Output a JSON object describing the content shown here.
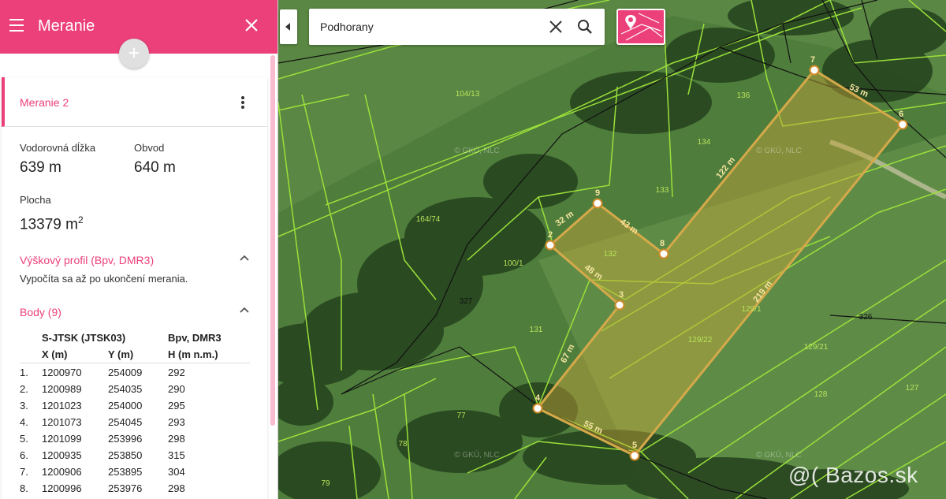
{
  "panel": {
    "title": "Meranie",
    "add_label": "+",
    "measurement": {
      "name": "Meranie 2",
      "horizontal_length_label": "Vodorovná dĺžka",
      "horizontal_length_value": "639 m",
      "perimeter_label": "Obvod",
      "perimeter_value": "640 m",
      "area_label": "Plocha",
      "area_value": "13379 m",
      "area_unit_sup": "2",
      "elevation_title": "Výškový profil (Bpv, DMR3)",
      "elevation_note": "Vypočíta sa až po ukončení merania.",
      "points_title": "Body (9)",
      "table": {
        "crs_header": "S-JTSK (JTSK03)",
        "height_crs_header": "Bpv, DMR3",
        "col_x": "X (m)",
        "col_y": "Y (m)",
        "col_h": "H (m n.m.)",
        "rows": [
          {
            "n": "1.",
            "x": "1200970",
            "y": "254009",
            "h": "292"
          },
          {
            "n": "2.",
            "x": "1200989",
            "y": "254035",
            "h": "290"
          },
          {
            "n": "3.",
            "x": "1201023",
            "y": "254000",
            "h": "295"
          },
          {
            "n": "4.",
            "x": "1201073",
            "y": "254045",
            "h": "293"
          },
          {
            "n": "5.",
            "x": "1201099",
            "y": "253996",
            "h": "298"
          },
          {
            "n": "6.",
            "x": "1200935",
            "y": "253850",
            "h": "315"
          },
          {
            "n": "7.",
            "x": "1200906",
            "y": "253895",
            "h": "304"
          },
          {
            "n": "8.",
            "x": "1200996",
            "y": "253976",
            "h": "298"
          }
        ]
      }
    }
  },
  "search": {
    "value": "Podhorany"
  },
  "map": {
    "accent": "#ec407a",
    "polygon_color": "#c8a63a",
    "parcel_line_color": "#9be03a",
    "vertex_labels": [
      "1",
      "2",
      "3",
      "4",
      "5",
      "6",
      "7",
      "8",
      "9"
    ],
    "segment_labels": [
      "32 m",
      "43 m",
      "48 m",
      "67 m",
      "55 m",
      "219 m",
      "53 m",
      "122 m"
    ],
    "parcel_labels": [
      "104/13",
      "136",
      "134",
      "133",
      "164/74",
      "132",
      "100/1",
      "131",
      "129/22",
      "129/1",
      "326",
      "327",
      "129/21",
      "128",
      "127",
      "77",
      "78",
      "79"
    ],
    "copyright_labels": [
      "© GKÚ, NLC",
      "© GKÚ, NLC",
      "© GKÚ, NLC",
      "© GKÚ, NLC"
    ],
    "watermark": "@( Bazos.sk"
  }
}
